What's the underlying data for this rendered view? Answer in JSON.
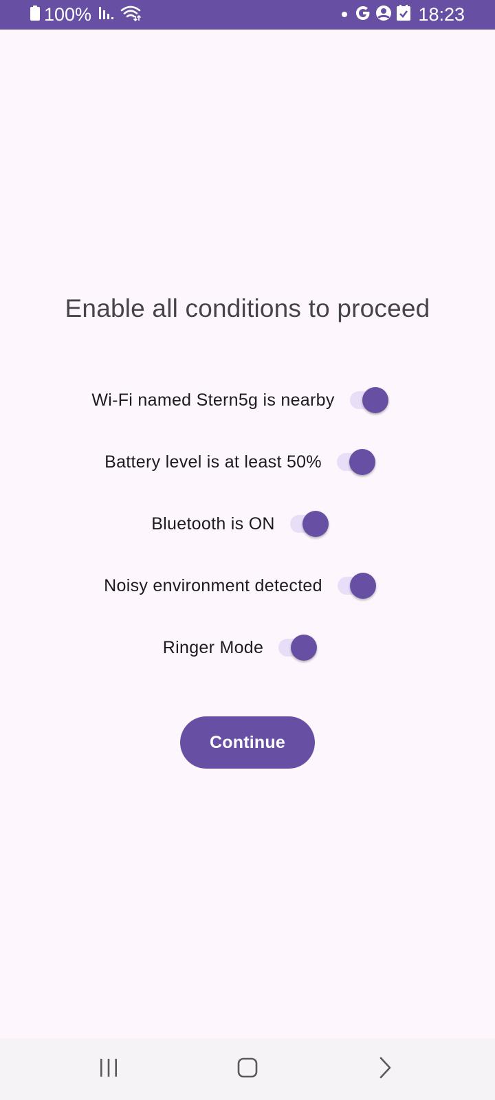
{
  "status_bar": {
    "battery_text": "100%",
    "time": "18:23",
    "icons": [
      "battery-icon",
      "signal-icon",
      "wifi-icon",
      "notification-dot-icon",
      "google-icon",
      "account-icon",
      "checkbox-icon"
    ]
  },
  "title": "Enable all conditions to proceed",
  "conditions": [
    {
      "label": "Wi-Fi named Stern5g is nearby",
      "enabled": true
    },
    {
      "label": "Battery level is at least 50%",
      "enabled": true
    },
    {
      "label": "Bluetooth is ON",
      "enabled": true
    },
    {
      "label": "Noisy environment detected",
      "enabled": true
    },
    {
      "label": "Ringer Mode",
      "enabled": true
    }
  ],
  "continue_label": "Continue",
  "nav_bar": {
    "icons": [
      "recents-icon",
      "home-icon",
      "back-icon"
    ]
  },
  "colors": {
    "primary": "#6750a4",
    "switch_track": "#e8def8",
    "background": "#fdf7fd",
    "nav_background": "#f5f3f6"
  }
}
